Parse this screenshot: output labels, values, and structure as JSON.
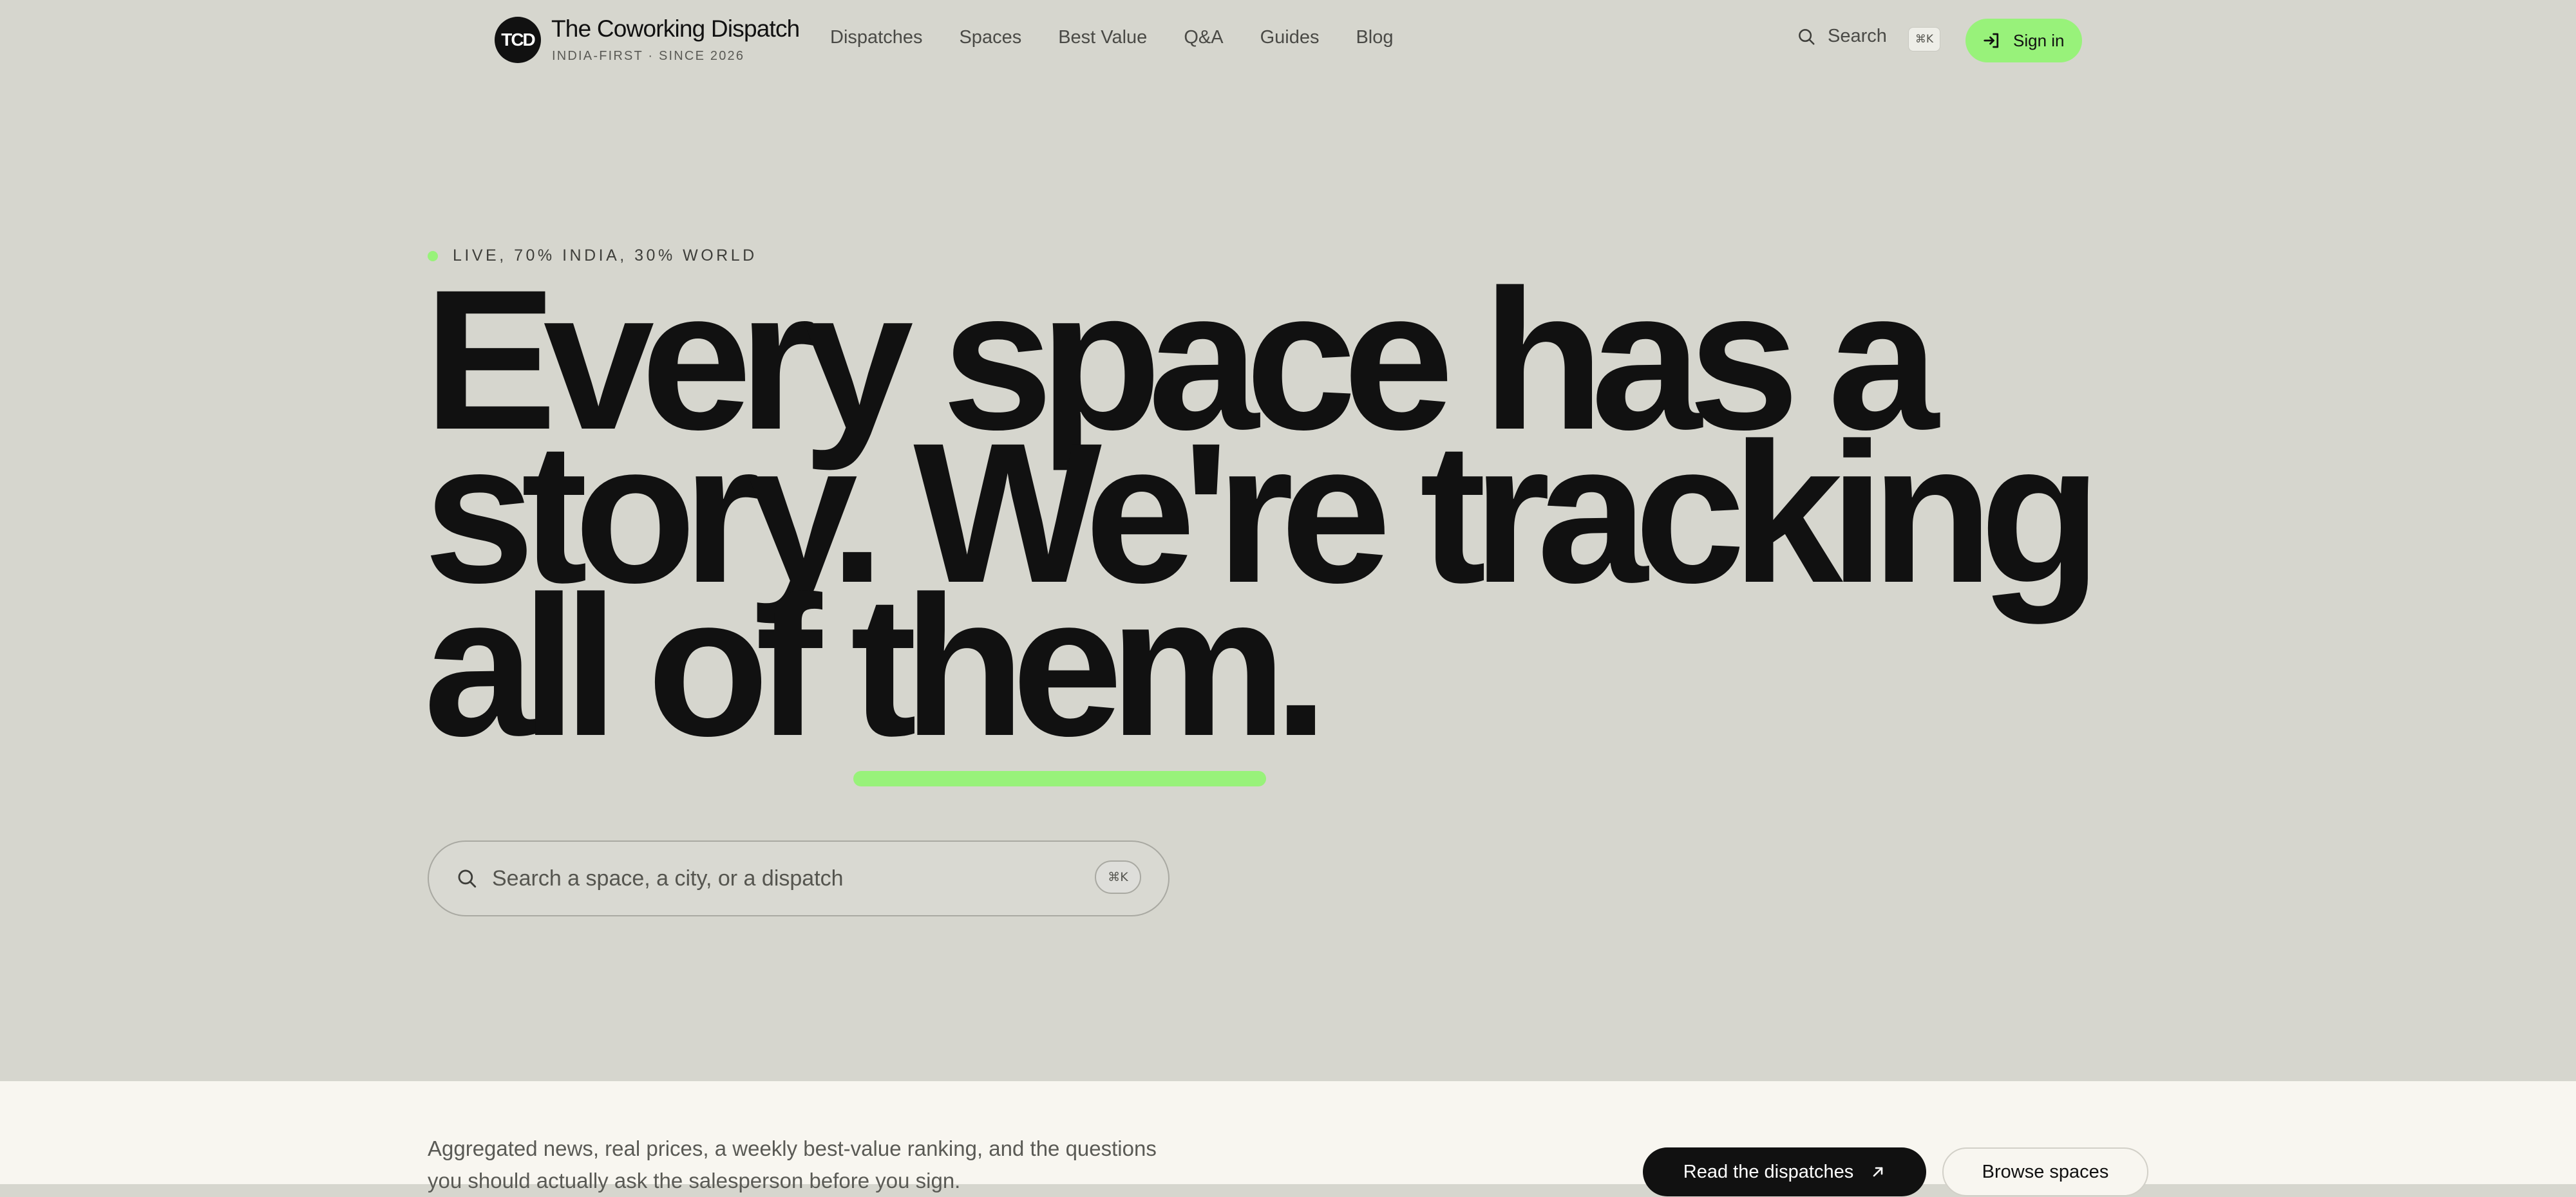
{
  "header": {
    "logo_text": "TCD",
    "brand_name": "The Coworking Dispatch",
    "brand_tagline": "INDIA-FIRST · SINCE 2026",
    "nav": [
      {
        "label": "Dispatches"
      },
      {
        "label": "Spaces"
      },
      {
        "label": "Best Value"
      },
      {
        "label": "Q&A"
      },
      {
        "label": "Guides"
      },
      {
        "label": "Blog"
      }
    ],
    "search_label": "Search",
    "search_shortcut": "⌘K",
    "signin_label": "Sign in",
    "search_icon": "search-icon",
    "signin_icon": "sign-in-icon"
  },
  "hero": {
    "status_label": "LIVE, 70% INDIA, 30% WORLD",
    "headline_lines": [
      "Every space has a",
      "story. We're tracking",
      "all of them."
    ],
    "search_placeholder": "Search a space, a city, or a dispatch",
    "search_shortcut": "⌘K"
  },
  "lower": {
    "description": "Aggregated news, real prices, a weekly best-value ranking, and the questions you should actually ask the salesperson before you sign.",
    "primary_button": "Read the dispatches",
    "secondary_button": "Browse spaces",
    "primary_icon": "arrow-up-right-icon"
  },
  "colors": {
    "background": "#d6d6ce",
    "accent": "#98f27a",
    "text": "#111111",
    "lower_band": "#f8f6f0"
  }
}
